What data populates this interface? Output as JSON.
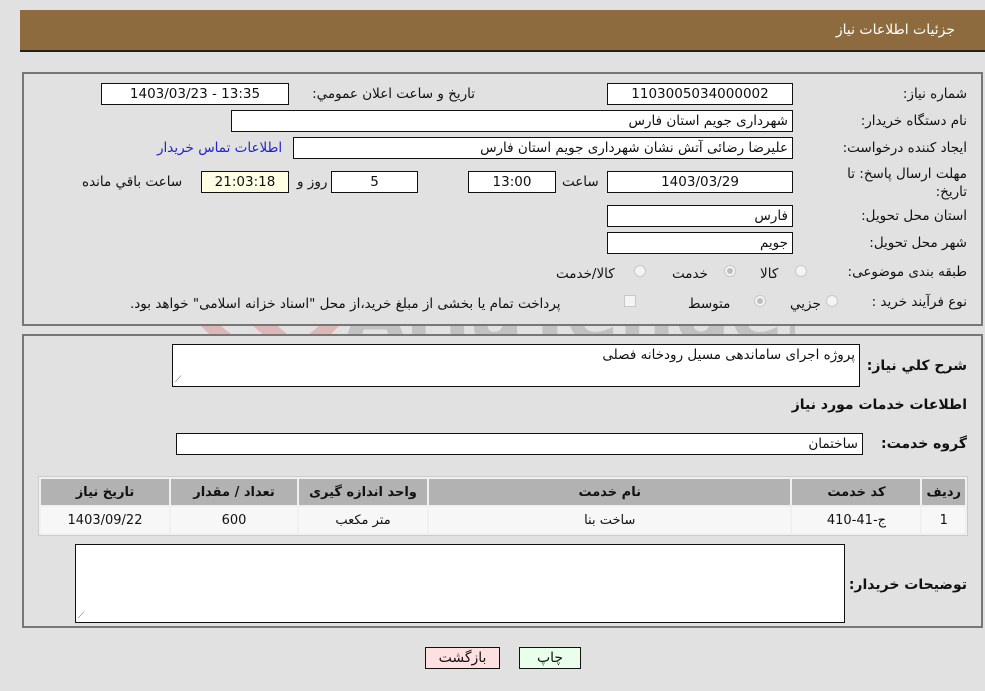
{
  "header": {
    "title": "جزئیات اطلاعات نیاز"
  },
  "form": {
    "need_number": {
      "label": "شماره نیاز:",
      "value": "1103005034000002"
    },
    "announce_datetime": {
      "label": "تاریخ و ساعت اعلان عمومي:",
      "value": "1403/03/23 - 13:35"
    },
    "buyer_org": {
      "label": "نام دستگاه خریدار:",
      "value": "شهرداری جویم استان فارس"
    },
    "requester": {
      "label": "ایجاد کننده درخواست:",
      "value": "علیرضا رضائی آتش نشان شهرداری جویم استان فارس"
    },
    "buyer_contact_link": "اطلاعات تماس خریدار",
    "deadline": {
      "label": "مهلت ارسال پاسخ: تا تاریخ:",
      "date": "1403/03/29",
      "time_label": "ساعت",
      "time": "13:00",
      "days": "5",
      "days_label": "روز و",
      "remaining": "21:03:18",
      "remaining_label": "ساعت باقي مانده"
    },
    "delivery_province": {
      "label": "استان محل تحویل:",
      "value": "فارس"
    },
    "delivery_city": {
      "label": "شهر محل تحویل:",
      "value": "جویم"
    },
    "category": {
      "label": "طبقه بندی موضوعی:",
      "options": [
        "کالا",
        "خدمت",
        "کالا/خدمت"
      ],
      "selected": "خدمت"
    },
    "purchase_type": {
      "label": "نوع فرآیند خرید :",
      "options": [
        "جزیي",
        "متوسط"
      ],
      "selected": "متوسط",
      "treasury_note": "پرداخت تمام یا بخشی از مبلغ خرید،از محل \"اسناد خزانه اسلامی\" خواهد بود."
    }
  },
  "details": {
    "summary_label": "شرح کلي نیاز:",
    "summary_value": "پروژه اجرای ساماندهی مسیل رودخانه فصلی",
    "services_heading": "اطلاعات خدمات مورد نیاز",
    "service_group_label": "گروه خدمت:",
    "service_group_value": "ساختمان",
    "table": {
      "headers": [
        "ردیف",
        "کد خدمت",
        "نام خدمت",
        "واحد اندازه گیری",
        "تعداد / مقدار",
        "تاریخ نیاز"
      ],
      "rows": [
        [
          "1",
          "ج-41-410",
          "ساخت بنا",
          "متر مکعب",
          "600",
          "1403/09/22"
        ]
      ]
    },
    "buyer_notes_label": "توضیحات خریدار:",
    "buyer_notes_value": ""
  },
  "buttons": {
    "print": "چاپ",
    "back": "بازگشت"
  },
  "watermark": "AriaTender.neT",
  "colors": {
    "header_bg": "#8d6b3f",
    "print_bg": "#eaffea",
    "back_bg": "#ffe0e0",
    "link": "#2222cc"
  }
}
